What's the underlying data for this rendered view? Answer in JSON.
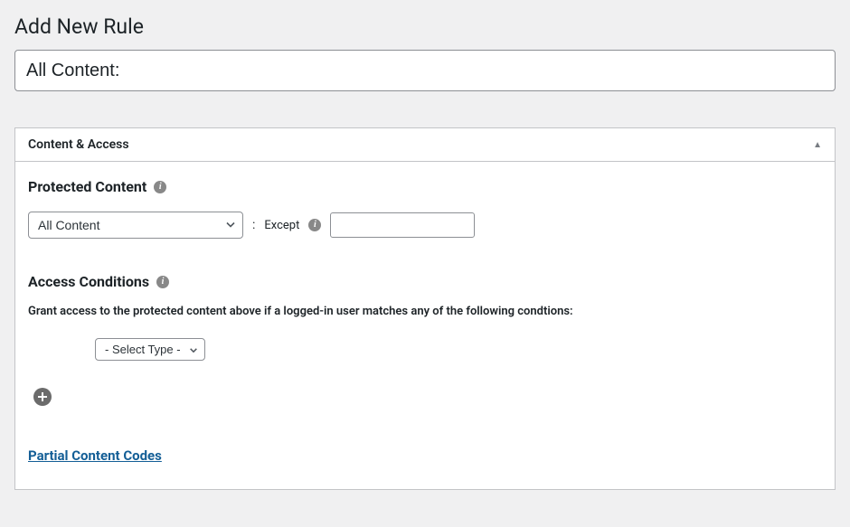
{
  "page": {
    "title": "Add New Rule"
  },
  "title_input": {
    "value": "All Content:"
  },
  "metabox": {
    "title": "Content & Access",
    "sections": {
      "protected": {
        "heading": "Protected Content",
        "select_value": "All Content",
        "except_label": "Except",
        "except_value": ""
      },
      "access": {
        "heading": "Access Conditions",
        "description": "Grant access to the protected content above if a logged-in user matches any of the following condtions:",
        "type_select_value": "- Select Type -"
      }
    },
    "partial_link": "Partial Content Codes"
  }
}
